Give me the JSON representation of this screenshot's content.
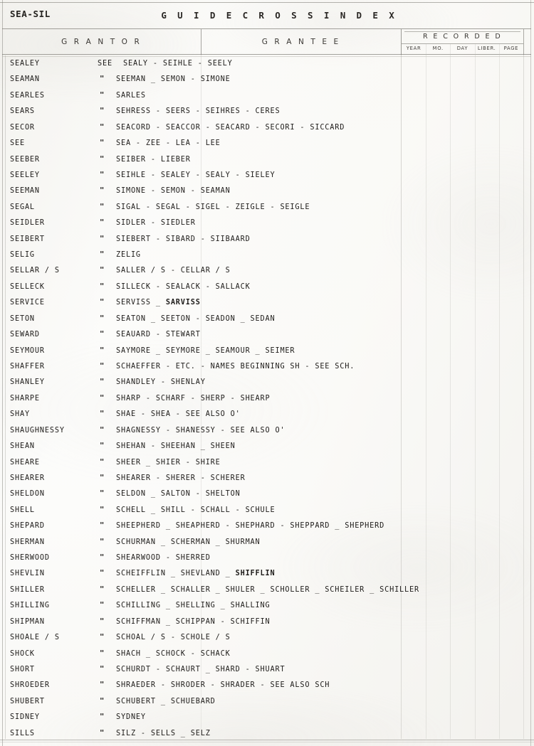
{
  "page": {
    "corner_id": "SEA-SIL",
    "title": "G U I D E   C R O S S   I N D E X"
  },
  "columns": {
    "grantor": "G R A N T O R",
    "grantee": "G R A N T E E",
    "recorded": "R E C O R D E D",
    "recorded_sub": [
      "YEAR",
      "MO.",
      "DAY",
      "LIBER.",
      "PAGE"
    ]
  },
  "rows": [
    {
      "grantor": "SEALEY",
      "ref": "SEE",
      "grantee": "SEALY - SEIHLE - SEELY"
    },
    {
      "grantor": "SEAMAN",
      "ref": "\"",
      "grantee": "SEEMAN _ SEMON - SIMONE"
    },
    {
      "grantor": "SEARLES",
      "ref": "\"",
      "grantee": "SARLES"
    },
    {
      "grantor": "SEARS",
      "ref": "\"",
      "grantee": "SEHRESS - SEERS - SEIHRES - CERES"
    },
    {
      "grantor": "SECOR",
      "ref": "\"",
      "grantee": "SEACORD - SEACCOR - SEACARD - SECORI - SICCARD"
    },
    {
      "grantor": "SEE",
      "ref": "\"",
      "grantee": "SEA - ZEE - LEA - LEE"
    },
    {
      "grantor": "SEEBER",
      "ref": "\"",
      "grantee": "SEIBER - LIEBER"
    },
    {
      "grantor": "SEELEY",
      "ref": "\"",
      "grantee": "SEIHLE - SEALEY - SEALY - SIELEY"
    },
    {
      "grantor": "SEEMAN",
      "ref": "\"",
      "grantee": "SIMONE - SEMON - SEAMAN"
    },
    {
      "grantor": "SEGAL",
      "ref": "\"",
      "grantee": "SIGAL - SEGAL - SIGEL - ZEIGLE - SEIGLE"
    },
    {
      "grantor": "SEIDLER",
      "ref": "\"",
      "grantee": "SIDLER - SIEDLER"
    },
    {
      "grantor": "SEIBERT",
      "ref": "\"",
      "grantee": "SIEBERT - SIBARD - SIIBAARD"
    },
    {
      "grantor": "SELIG",
      "ref": "\"",
      "grantee": "ZELIG"
    },
    {
      "grantor": "SELLAR / S",
      "ref": "\"",
      "grantee": "SALLER / S - CELLAR / S"
    },
    {
      "grantor": "SELLECK",
      "ref": "\"",
      "grantee": "SILLECK - SEALACK - SALLACK"
    },
    {
      "grantor": "SERVICE",
      "ref": "\"",
      "grantee": "SERVISS _ SARVISS",
      "bold_tail": "SARVISS"
    },
    {
      "grantor": "SETON",
      "ref": "\"",
      "grantee": "SEATON _ SEETON - SEADON _ SEDAN"
    },
    {
      "grantor": "SEWARD",
      "ref": "\"",
      "grantee": "SEAUARD - STEWART"
    },
    {
      "grantor": "SEYMOUR",
      "ref": "\"",
      "grantee": "SAYMORE _ SEYMORE _ SEAMOUR _ SEIMER"
    },
    {
      "grantor": "SHAFFER",
      "ref": "\"",
      "grantee": "SCHAEFFER - ETC. - NAMES BEGINNING SH - SEE SCH."
    },
    {
      "grantor": "SHANLEY",
      "ref": "\"",
      "grantee": "SHANDLEY - SHENLAY"
    },
    {
      "grantor": "SHARPE",
      "ref": "\"",
      "grantee": "SHARP - SCHARF - SHERP - SHEARP"
    },
    {
      "grantor": "SHAY",
      "ref": "\"",
      "grantee": "SHAE - SHEA - SEE ALSO O'"
    },
    {
      "grantor": "SHAUGHNESSY",
      "ref": "\"",
      "grantee": "SHAGNESSY - SHANESSY - SEE ALSO O'"
    },
    {
      "grantor": "SHEAN",
      "ref": "\"",
      "grantee": "SHEHAN - SHEEHAN _ SHEEN"
    },
    {
      "grantor": "SHEARE",
      "ref": "\"",
      "grantee": "SHEER _ SHIER - SHIRE"
    },
    {
      "grantor": "SHEARER",
      "ref": "\"",
      "grantee": "SHEARER - SHERER - SCHERER"
    },
    {
      "grantor": "SHELDON",
      "ref": "\"",
      "grantee": "SELDON _ SALTON - SHELTON"
    },
    {
      "grantor": "SHELL",
      "ref": "\"",
      "grantee": "SCHELL _ SHILL - SCHALL - SCHULE"
    },
    {
      "grantor": "SHEPARD",
      "ref": "\"",
      "grantee": "SHEEPHERD _ SHEAPHERD - SHEPHARD - SHEPPARD _ SHEPHERD"
    },
    {
      "grantor": "SHERMAN",
      "ref": "\"",
      "grantee": "SCHURMAN _ SCHERMAN _ SHURMAN"
    },
    {
      "grantor": "SHERWOOD",
      "ref": "\"",
      "grantee": "SHEARWOOD - SHERRED"
    },
    {
      "grantor": "SHEVLIN",
      "ref": "\"",
      "grantee": "SCHEIFFLIN _ SHEVLAND _ SHIFFLIN",
      "bold_tail": "SHIFFLIN"
    },
    {
      "grantor": "SHILLER",
      "ref": "\"",
      "grantee": "SCHELLER _ SCHALLER _ SHULER _ SCHOLLER _ SCHEILER _ SCHILLER"
    },
    {
      "grantor": "SHILLING",
      "ref": "\"",
      "grantee": "SCHILLING _ SHELLING _ SHALLING"
    },
    {
      "grantor": "SHIPMAN",
      "ref": "\"",
      "grantee": "SCHIFFMAN _ SCHIPPAN - SCHIFFIN"
    },
    {
      "grantor": "SHOALE / S",
      "ref": "\"",
      "grantee": "SCHOAL / S - SCHOLE / S"
    },
    {
      "grantor": "SHOCK",
      "ref": "\"",
      "grantee": "SHACH _ SCHOCK - SCHACK"
    },
    {
      "grantor": "SHORT",
      "ref": "\"",
      "grantee": "SCHURDT - SCHAURT _ SHARD - SHUART"
    },
    {
      "grantor": "SHROEDER",
      "ref": "\"",
      "grantee": "SHRAEDER - SHRODER - SHRADER - SEE ALSO   SCH"
    },
    {
      "grantor": "SHUBERT",
      "ref": "\"",
      "grantee": "SCHUBERT _ SCHUEBARD"
    },
    {
      "grantor": "SIDNEY",
      "ref": "\"",
      "grantee": "SYDNEY"
    },
    {
      "grantor": "SILLS",
      "ref": "\"",
      "grantee": "SILZ - SELLS _ SELZ"
    }
  ]
}
